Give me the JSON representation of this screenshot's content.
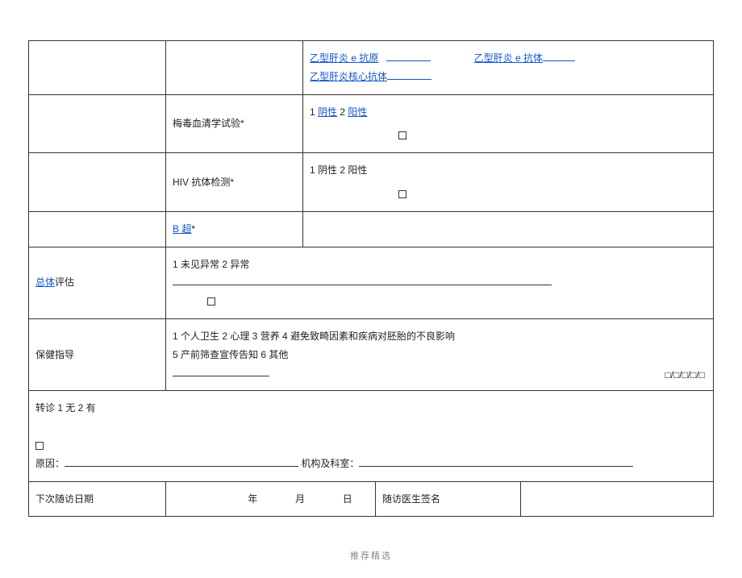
{
  "r1": {
    "l1_link": "乙型肝炎 e 抗原",
    "l2_link": "乙型肝炎 e 抗体",
    "l3_link": "乙型肝炎核心抗体"
  },
  "r2": {
    "label": "梅毒血清学试验*",
    "opt_prefix": "1 ",
    "opt1": "阴性",
    "opt_mid": " 2 ",
    "opt2": "阳性"
  },
  "r3": {
    "label": "HIV 抗体检测*",
    "opts": "1 阴性 2 阳性"
  },
  "r4": {
    "label_link": "B 超",
    "label_suffix": "*"
  },
  "r5": {
    "label_link": "总体",
    "label_rest": "评估",
    "opts": "1 未见异常 2 异常"
  },
  "r6": {
    "label": "保健指导",
    "line1": "1 个人卫生    2 心理        3 营养    4 避免致畸因素和疾病对胚胎的不良影响",
    "line2": "5 产前筛查宣传告知        6 其他",
    "boxes": "□/□/□/□/□"
  },
  "r7": {
    "referral": "转诊    1 无    2 有",
    "reason_label": "原因：",
    "institution_label": "机构及科室：",
    "date_label": "下次随访日期",
    "year": "年",
    "month": "月",
    "day": "日",
    "doctor_label": "随访医生签名"
  },
  "footer": "推荐精选"
}
